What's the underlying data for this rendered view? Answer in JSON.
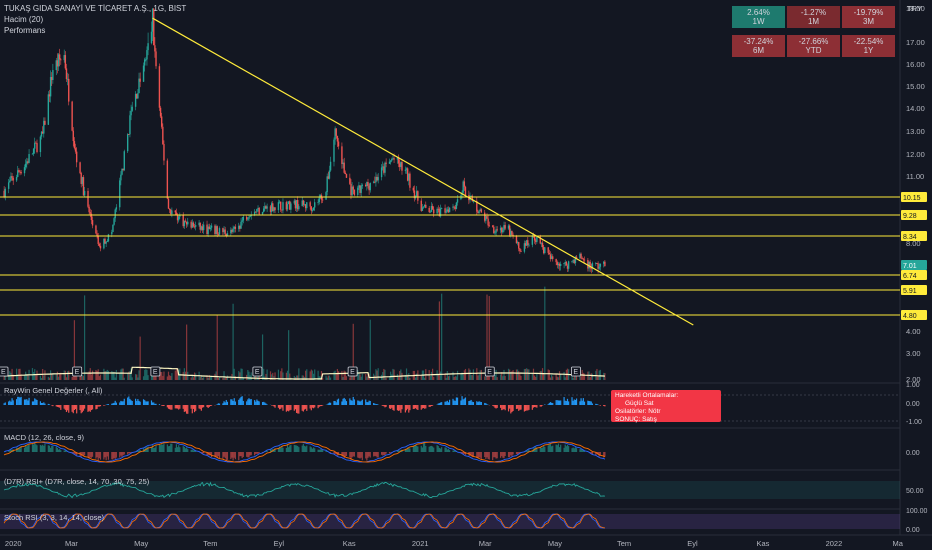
{
  "header": {
    "title": "TUKAŞ GIDA SANAYİ VE TİCARET A.Ş., 1G, BIST",
    "volume_label": "Hacim (20)",
    "performance_label": "Performans",
    "currency": "TRY"
  },
  "performance": [
    {
      "value": "2.64%",
      "period": "1W",
      "color": "#1e7a6e"
    },
    {
      "value": "-1.27%",
      "period": "1M",
      "color": "#7a2a2f"
    },
    {
      "value": "-19.79%",
      "period": "3M",
      "color": "#8d2f35"
    },
    {
      "value": "-37.24%",
      "period": "6M",
      "color": "#8d2f35"
    },
    {
      "value": "-27.66%",
      "period": "YTD",
      "color": "#8d2f35"
    },
    {
      "value": "-22.54%",
      "period": "1Y",
      "color": "#8d2f35"
    }
  ],
  "signal_box": {
    "ma_label": "Hareketli Ortalamalar:",
    "ma_value": "Güçlü Sat",
    "osc_label": "Osilatörler: Nötr",
    "result_label": "SONUÇ: Satış"
  },
  "indicators": {
    "raywin": "RayWin Genel Değerler (, All)",
    "macd": "MACD (12, 26, close, 9)",
    "rsi": "(D7R) RSI+ (D7R, close, 14, 70, 30, 75, 25)",
    "stoch": "Stoch RSI (3, 3, 14, 14, close)"
  },
  "colors": {
    "background": "#131722",
    "up": "#26a69a",
    "down": "#ef5350",
    "level_line": "#ffeb3b",
    "trendline": "#ffeb3b"
  },
  "chart_data": {
    "type": "candlestick",
    "symbol": "TUKAŞ GIDA SANAYİ VE TİCARET A.Ş.",
    "timeframe": "1G",
    "x_ticks": [
      "2020",
      "Mar",
      "May",
      "Tem",
      "Eyl",
      "Kas",
      "2021",
      "Mar",
      "May",
      "Tem",
      "Eyl",
      "Kas",
      "2022",
      "Ma"
    ],
    "y_ticks": [
      18.0,
      17.0,
      16.0,
      15.0,
      14.0,
      13.0,
      12.0,
      11.0,
      8.0,
      4.0,
      3.0,
      2.0
    ],
    "y_scale": "log",
    "last_price": 7.01,
    "price_path": [
      {
        "date": "2020-01-02",
        "price": 10.4
      },
      {
        "date": "2020-01-20",
        "price": 11.5
      },
      {
        "date": "2020-02-05",
        "price": 12.8
      },
      {
        "date": "2020-02-14",
        "price": 15.8
      },
      {
        "date": "2020-02-24",
        "price": 16.4
      },
      {
        "date": "2020-03-05",
        "price": 12.0
      },
      {
        "date": "2020-03-16",
        "price": 9.6
      },
      {
        "date": "2020-03-26",
        "price": 7.8
      },
      {
        "date": "2020-04-06",
        "price": 8.5
      },
      {
        "date": "2020-04-15",
        "price": 11.2
      },
      {
        "date": "2020-04-23",
        "price": 13.8
      },
      {
        "date": "2020-05-05",
        "price": 16.0
      },
      {
        "date": "2020-05-12",
        "price": 17.7
      },
      {
        "date": "2020-05-18",
        "price": 14.0
      },
      {
        "date": "2020-05-26",
        "price": 9.6
      },
      {
        "date": "2020-06-10",
        "price": 8.9
      },
      {
        "date": "2020-07-01",
        "price": 8.6
      },
      {
        "date": "2020-07-22",
        "price": 8.5
      },
      {
        "date": "2020-08-05",
        "price": 9.4
      },
      {
        "date": "2020-08-26",
        "price": 9.7
      },
      {
        "date": "2020-09-15",
        "price": 9.8
      },
      {
        "date": "2020-09-30",
        "price": 9.7
      },
      {
        "date": "2020-10-12",
        "price": 10.4
      },
      {
        "date": "2020-10-20",
        "price": 13.0
      },
      {
        "date": "2020-10-28",
        "price": 11.2
      },
      {
        "date": "2020-11-05",
        "price": 10.2
      },
      {
        "date": "2020-11-25",
        "price": 10.9
      },
      {
        "date": "2020-12-10",
        "price": 11.8
      },
      {
        "date": "2020-12-21",
        "price": 11.2
      },
      {
        "date": "2021-01-05",
        "price": 9.6
      },
      {
        "date": "2021-01-20",
        "price": 9.4
      },
      {
        "date": "2021-02-03",
        "price": 9.8
      },
      {
        "date": "2021-02-10",
        "price": 10.6
      },
      {
        "date": "2021-02-22",
        "price": 9.6
      },
      {
        "date": "2021-03-08",
        "price": 8.7
      },
      {
        "date": "2021-03-22",
        "price": 8.6
      },
      {
        "date": "2021-04-01",
        "price": 7.7
      },
      {
        "date": "2021-04-14",
        "price": 8.3
      },
      {
        "date": "2021-04-28",
        "price": 7.3
      },
      {
        "date": "2021-05-10",
        "price": 7.0
      },
      {
        "date": "2021-05-24",
        "price": 7.4
      },
      {
        "date": "2021-06-02",
        "price": 7.0
      },
      {
        "date": "2021-06-15",
        "price": 7.01
      }
    ],
    "horizontal_levels": [
      10.15,
      9.28,
      8.34,
      6.74,
      5.91,
      4.8
    ],
    "trendline": [
      {
        "date": "2020-05-12",
        "price": 17.7
      },
      {
        "date": "2021-09-01",
        "price": 4.3
      }
    ],
    "earnings_markers": [
      "2020-01-01",
      "2020-03-06",
      "2020-05-14",
      "2020-08-12",
      "2020-11-04",
      "2021-03-05",
      "2021-05-20"
    ],
    "volume_ma_period": 20,
    "indicator_scales": {
      "raywin": [
        1.0,
        0.0,
        -1.0
      ],
      "macd": [
        0.0
      ],
      "rsi": [
        50.0
      ],
      "stoch_rsi": [
        100.0,
        0.0
      ]
    },
    "level_labels": [
      "10.15",
      "9.28",
      "8.34",
      "7.01",
      "6.74",
      "5.91",
      "4.80"
    ],
    "y_label_strings": [
      "18.00",
      "17.00",
      "16.00",
      "15.00",
      "14.00",
      "13.00",
      "12.00",
      "11.00",
      "8.00",
      "4.00",
      "3.00",
      "2.00"
    ],
    "indicator_label_strings": {
      "raywin": [
        "1.00",
        "0.00",
        "-1.00"
      ],
      "macd": [
        "0.00"
      ],
      "rsi": [
        "50.00"
      ],
      "stoch": [
        "100.00",
        "0.00"
      ]
    }
  }
}
